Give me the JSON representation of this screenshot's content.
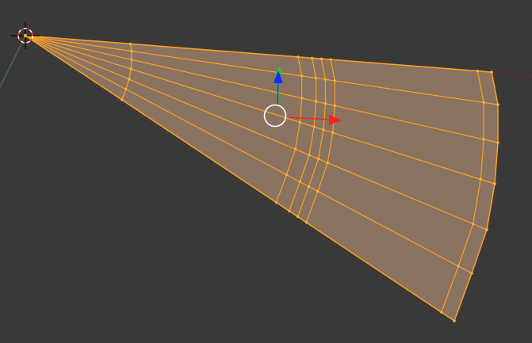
{
  "viewport": {
    "background": "#393939"
  },
  "mesh": {
    "face_color": "#8a7361",
    "edge_color": "#ffa020",
    "vertex_color": "#ffb030",
    "radial_edge_count": 7,
    "arc_edge_count": 7,
    "selected": true
  },
  "gizmo": {
    "x_axis_color": "#ff2020",
    "y_axis_color": "#22cc22",
    "z_axis_color": "#1030ff",
    "pivot_ring_color": "#ffffff",
    "icon": "move-gizmo-icon"
  },
  "cursor_3d": {
    "icon": "3d-cursor-icon",
    "ring_colors": [
      "#ff3030",
      "#ffffff"
    ]
  },
  "axis_lines": {
    "x_line_color": "#8a2020",
    "y_line_color": "#3a8a3a"
  }
}
